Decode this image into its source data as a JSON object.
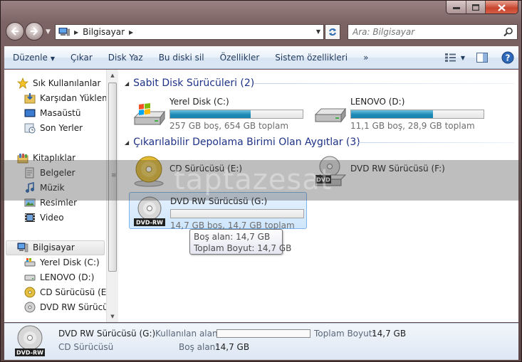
{
  "address": {
    "crumb": "Bilgisayar"
  },
  "search": {
    "placeholder": "Ara: Bilgisayar"
  },
  "toolbar": {
    "items": [
      "Düzenle",
      "Çıkar",
      "Disk Yaz",
      "Bu diski sil",
      "Özellikler",
      "Sistem özellikleri",
      "»"
    ]
  },
  "navpane": {
    "favorites": "Sık Kullanılanlar",
    "downloads": "Karşıdan Yüklem",
    "desktop": "Masaüstü",
    "recent": "Son Yerler",
    "libraries": "Kitaplıklar",
    "documents": "Belgeler",
    "music": "Müzik",
    "pictures": "Resimler",
    "videos": "Video",
    "computer": "Bilgisayar",
    "local_disk": "Yerel Disk (C:)",
    "lenovo": "LENOVO (D:)",
    "cd_drive": "CD Sürücüsü (E:)",
    "dvd_drive": "DVD RW Sürücüs"
  },
  "groups": {
    "hdd": "Sabit Disk Sürücüleri (2)",
    "removable": "Çıkarılabilir Depolama Birimi Olan Aygıtlar (3)"
  },
  "drives": {
    "c": {
      "name": "Yerel Disk (C:)",
      "size": "257 GB boş, 654 GB toplam",
      "used_fraction": 0.61
    },
    "d": {
      "name": "LENOVO (D:)",
      "size": "11,1 GB boş, 28,9 GB toplam",
      "used_fraction": 0.62
    },
    "e": {
      "name": "CD Sürücüsü (E:)"
    },
    "f": {
      "name": "DVD RW Sürücüsü (F:)",
      "icon_label": "DVD"
    },
    "g": {
      "name": "DVD RW Sürücüsü (G:)",
      "size": "14,7 GB boş, 14,7 GB toplam",
      "used_fraction": 0,
      "icon_label": "DVD-RW"
    }
  },
  "tooltip": {
    "free": "Boş alan: 14,7 GB",
    "total": "Toplam Boyut: 14,7 GB"
  },
  "watermark": "taptazesat",
  "details": {
    "name": "DVD RW Sürücüsü (G:)",
    "type": "CD Sürücüsü",
    "used_label": "Kullanılan alan:",
    "total_label": "Toplam Boyut:",
    "total_value": "14,7 GB",
    "free_label": "Boş alan:",
    "free_value": "14,7 GB",
    "icon_label": "DVD-RW"
  },
  "colors": {
    "group_heading": "#1e3287",
    "bar_fill": "#1f8bb7",
    "toolbar_text": "#1e395b",
    "selection": "#cfe6fc"
  }
}
